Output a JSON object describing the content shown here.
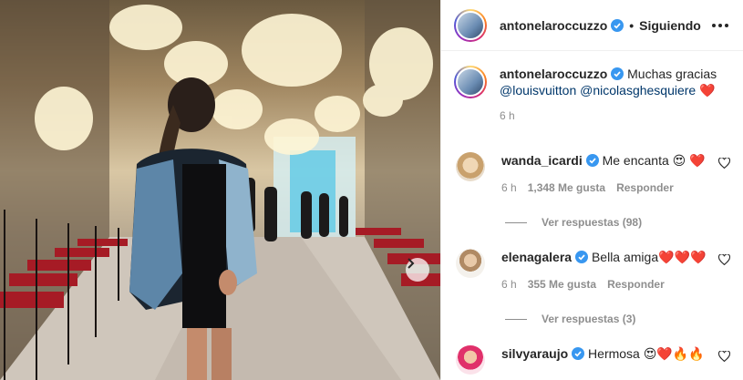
{
  "header": {
    "username": "antonelaroccuzzo",
    "separator": "•",
    "follow_status": "Siguiendo"
  },
  "caption": {
    "username": "antonelaroccuzzo",
    "text": "Muchas gracias",
    "mention1": "@louisvuitton",
    "mention2": "@nicolasghesquiere",
    "emoji": "❤️",
    "time": "6 h"
  },
  "comments": [
    {
      "username": "wanda_icardi",
      "text": "Me encanta 😍 ❤️",
      "time": "6 h",
      "likes": "1,348 Me gusta",
      "reply": "Responder",
      "view_replies": "Ver respuestas (98)"
    },
    {
      "username": "elenagalera",
      "text": "Bella amiga❤️❤️❤️",
      "time": "6 h",
      "likes": "355 Me gusta",
      "reply": "Responder",
      "view_replies": "Ver respuestas (3)"
    },
    {
      "username": "silvyaraujo",
      "text": "Hermosa 😍❤️🔥🔥"
    }
  ],
  "icons": {
    "verified": "verified-badge-icon",
    "more": "more-options-icon",
    "heart": "heart-outline-icon",
    "next": "chevron-right-icon"
  },
  "colors": {
    "verified": "#3897f0",
    "mention": "#00376b",
    "secondary_text": "#8e8e8e"
  }
}
